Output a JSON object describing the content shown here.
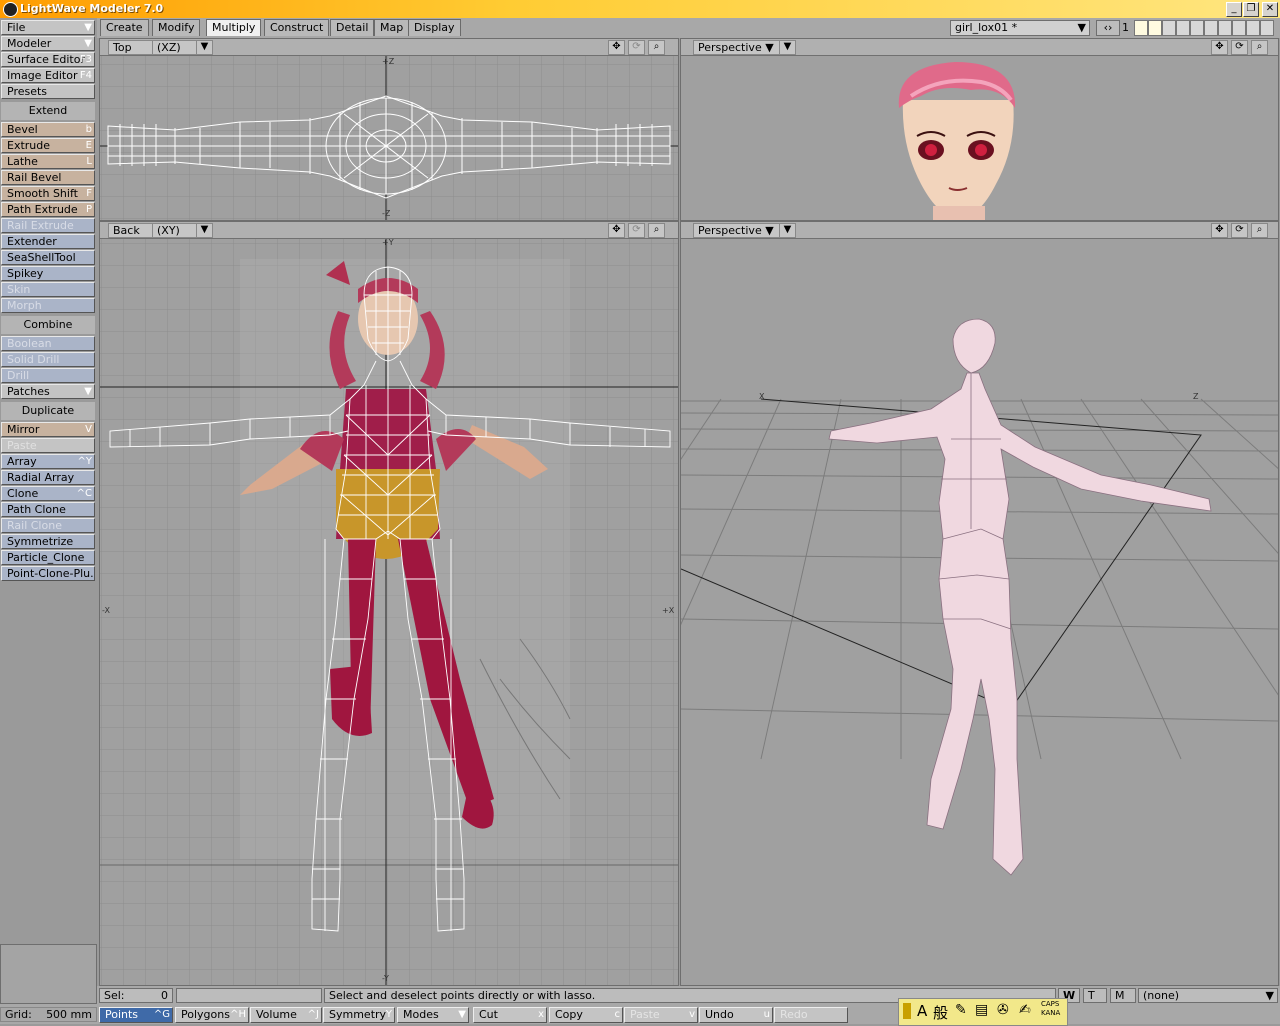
{
  "window": {
    "title": "LightWave Modeler 7.0",
    "min": "_",
    "restore": "❐",
    "close": "✕"
  },
  "tabs": [
    "Create",
    "Modify",
    "Multiply",
    "Construct",
    "Detail",
    "Map",
    "Display"
  ],
  "active_tab": "Multiply",
  "object_name": "girl_lox01 *",
  "layer_number": "1",
  "sidebar": {
    "top": [
      {
        "label": "File",
        "key": "▼",
        "style": "c-gray"
      },
      {
        "label": "Modeler",
        "key": "▼",
        "style": "c-gray"
      },
      {
        "label": "Surface Editor",
        "key": "F3",
        "style": "c-gray"
      },
      {
        "label": "Image Editor",
        "key": "F4",
        "style": "c-gray"
      },
      {
        "label": "Presets",
        "key": "",
        "style": "c-gray"
      }
    ],
    "extend_head": "Extend",
    "extend": [
      {
        "label": "Bevel",
        "key": "b",
        "style": "c-tan"
      },
      {
        "label": "Extrude",
        "key": "E",
        "style": "c-tan"
      },
      {
        "label": "Lathe",
        "key": "L",
        "style": "c-tan"
      },
      {
        "label": "Rail Bevel",
        "key": "",
        "style": "c-tan"
      },
      {
        "label": "Smooth Shift",
        "key": "F",
        "style": "c-tan"
      },
      {
        "label": "Path Extrude",
        "key": "P",
        "style": "c-tan"
      },
      {
        "label": "Rail Extrude",
        "key": "",
        "style": "c-dis"
      },
      {
        "label": "Extender",
        "key": "",
        "style": "c-blue"
      },
      {
        "label": "SeaShellTool",
        "key": "",
        "style": "c-blue"
      },
      {
        "label": "Spikey",
        "key": "",
        "style": "c-blue"
      },
      {
        "label": "Skin",
        "key": "",
        "style": "c-dis"
      },
      {
        "label": "Morph",
        "key": "",
        "style": "c-dis"
      }
    ],
    "combine_head": "Combine",
    "combine": [
      {
        "label": "Boolean",
        "key": "",
        "style": "c-dis"
      },
      {
        "label": "Solid Drill",
        "key": "",
        "style": "c-dis"
      },
      {
        "label": "Drill",
        "key": "",
        "style": "c-dis"
      },
      {
        "label": "Patches",
        "key": "▼",
        "style": "c-gray"
      }
    ],
    "duplicate_head": "Duplicate",
    "duplicate": [
      {
        "label": "Mirror",
        "key": "V",
        "style": "c-tan"
      },
      {
        "label": "Paste",
        "key": "",
        "style": "c-dis2"
      },
      {
        "label": "Array",
        "key": "^Y",
        "style": "c-blue"
      },
      {
        "label": "Radial Array",
        "key": "",
        "style": "c-blue"
      },
      {
        "label": "Clone",
        "key": "^C",
        "style": "c-blue"
      },
      {
        "label": "Path Clone",
        "key": "",
        "style": "c-blue"
      },
      {
        "label": "Rail Clone",
        "key": "",
        "style": "c-dis"
      },
      {
        "label": "Symmetrize",
        "key": "",
        "style": "c-blue"
      },
      {
        "label": "Particle_Clone",
        "key": "",
        "style": "c-blue"
      },
      {
        "label": "Point-Clone-Plu...",
        "key": "",
        "style": "c-blue"
      }
    ]
  },
  "viewports": {
    "top": {
      "label": "Top",
      "axes": "(XZ)"
    },
    "back": {
      "label": "Back",
      "axes": "(XY)"
    },
    "persp1": {
      "label": "Perspective"
    },
    "persp2": {
      "label": "Perspective"
    }
  },
  "axis_labels": {
    "plus_z": "+Z",
    "minus_z": "-Z",
    "plus_y": "+Y",
    "minus_y": "-Y",
    "minus_x": "-X",
    "plus_x": "+X",
    "p_x": "X",
    "p_z": "Z"
  },
  "status": {
    "grid_label": "Grid:",
    "grid_value": "500 mm",
    "sel_label": "Sel:",
    "sel_value": "0",
    "message": "Select and deselect points directly or with lasso.",
    "w": "W",
    "t": "T",
    "m": "M",
    "none": "(none)"
  },
  "modes": [
    {
      "label": "Points",
      "key": "^G",
      "state": "sel"
    },
    {
      "label": "Polygons",
      "key": "^H",
      "state": ""
    },
    {
      "label": "Volume",
      "key": "^J",
      "state": ""
    },
    {
      "label": "Symmetry",
      "key": "Y",
      "state": ""
    },
    {
      "label": "Modes",
      "key": "▼",
      "state": ""
    },
    {
      "label": "Cut",
      "key": "x",
      "state": ""
    },
    {
      "label": "Copy",
      "key": "c",
      "state": ""
    },
    {
      "label": "Paste",
      "key": "v",
      "state": "dis"
    },
    {
      "label": "Undo",
      "key": "u",
      "state": ""
    },
    {
      "label": "Redo",
      "key": "",
      "state": "dis"
    }
  ],
  "ime": {
    "a": "A",
    "han": "般",
    "caps": "CAPS",
    "kana": "KANA"
  },
  "colors": {
    "accent": "#3f6aa8",
    "title_start": "#ff9c00",
    "viewport_bg": "#a0a0a0"
  }
}
